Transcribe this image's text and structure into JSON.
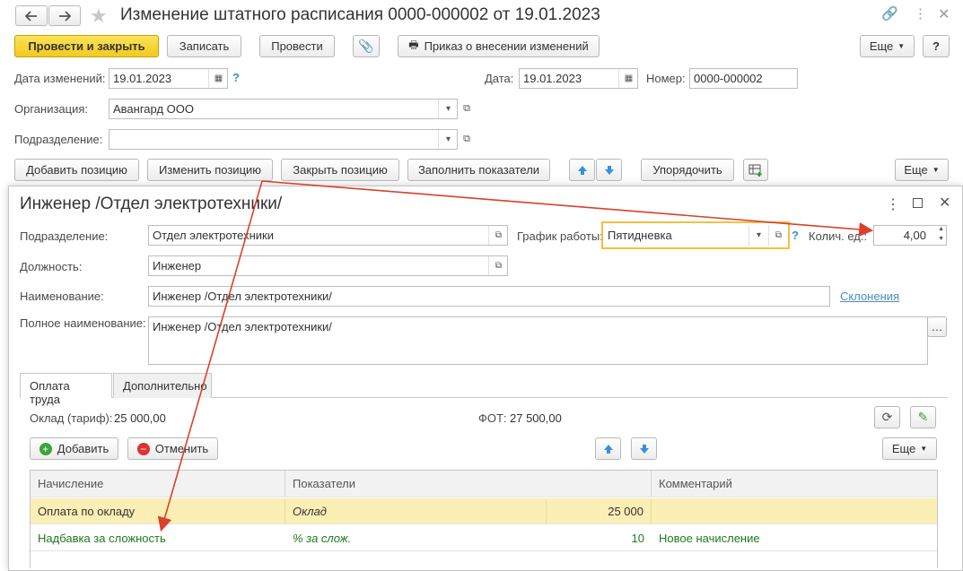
{
  "window": {
    "title": "Изменение штатного расписания 0000-000002 от 19.01.2023"
  },
  "toolbar": {
    "post_close": "Провести и закрыть",
    "save": "Записать",
    "post": "Провести",
    "order": "Приказ о внесении изменений",
    "more": "Еще",
    "help": "?"
  },
  "header": {
    "change_date_label": "Дата изменений:",
    "change_date": "19.01.2023",
    "date_label": "Дата:",
    "date": "19.01.2023",
    "number_label": "Номер:",
    "number": "0000-000002",
    "org_label": "Организация:",
    "org": "Авангард ООО",
    "dept_label": "Подразделение:",
    "dept": ""
  },
  "positions_toolbar": {
    "add": "Добавить позицию",
    "edit": "Изменить позицию",
    "close": "Закрыть позицию",
    "fill": "Заполнить показатели",
    "sort": "Упорядочить",
    "more": "Еще"
  },
  "dialog": {
    "title": "Инженер /Отдел электротехники/",
    "dept_label": "Подразделение:",
    "dept": "Отдел электротехники",
    "schedule_label": "График работы:",
    "schedule": "Пятидневка",
    "units_label": "Колич. ед.:",
    "units": "4,00",
    "position_label": "Должность:",
    "position": "Инженер",
    "name_label": "Наименование:",
    "name": "Инженер /Отдел электротехники/",
    "declension_link": "Склонения",
    "fullname_label": "Полное наименование:",
    "fullname": "Инженер /Отдел электротехники/",
    "tabs": [
      "Оплата труда",
      "Дополнительно"
    ],
    "salary_label": "Оклад (тариф):",
    "salary": "25 000,00",
    "fot_label": "ФОТ:",
    "fot": "27 500,00",
    "add": "Добавить",
    "cancel": "Отменить",
    "more": "Еще",
    "columns": [
      "Начисление",
      "Показатели",
      "Комментарий"
    ],
    "rows": [
      {
        "accrual": "Оплата по окладу",
        "indicator": "Оклад",
        "value": "25 000",
        "comment": ""
      },
      {
        "accrual": "Надбавка за сложность",
        "indicator": "% за слож.",
        "value": "10",
        "comment": "Новое начисление"
      }
    ]
  },
  "colors": {
    "highlight_row": "#fcefb5",
    "new_row_text": "#1f7a1f",
    "annotation_arrow": "#d9412b",
    "focus_border": "#f0c040"
  }
}
